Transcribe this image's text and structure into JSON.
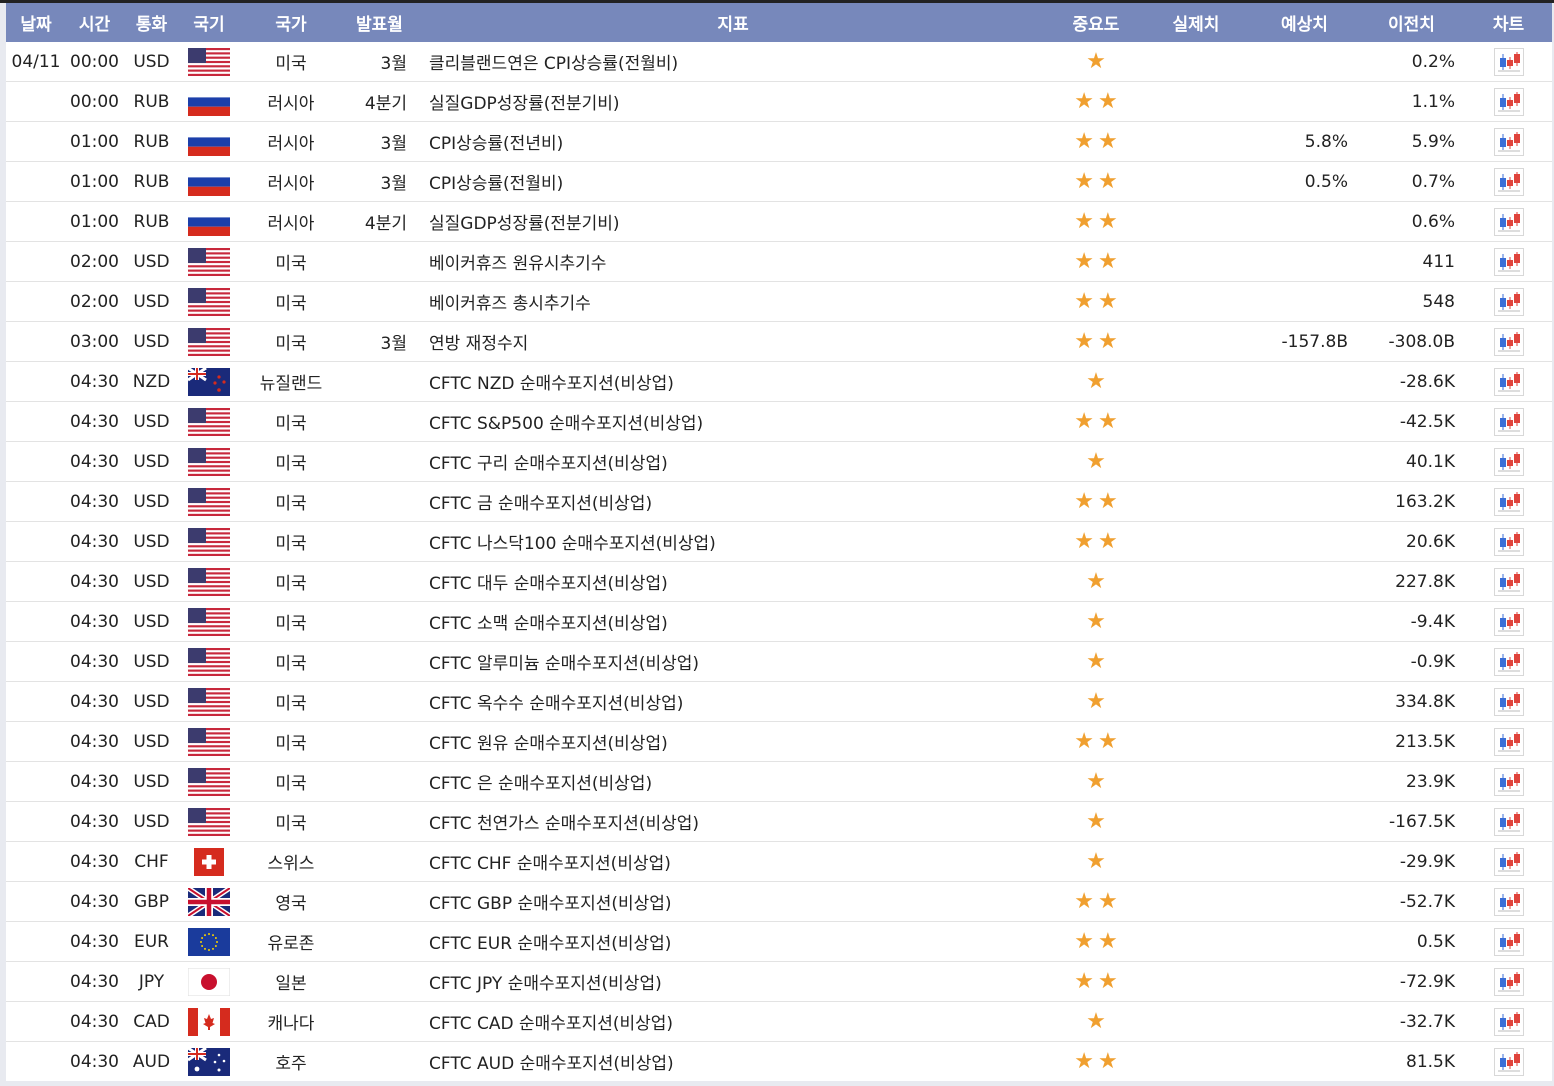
{
  "header": {
    "date": "날짜",
    "time": "시간",
    "currency": "통화",
    "flag": "국기",
    "country": "국가",
    "month": "발표월",
    "indicator": "지표",
    "importance": "중요도",
    "actual": "실제치",
    "forecast": "예상치",
    "previous": "이전치",
    "chart": "차트"
  },
  "colors": {
    "header_bg": "#7788bb",
    "star": "#f0a030",
    "chart_red": "#e0433b",
    "chart_blue": "#3b6fd8"
  },
  "rows": [
    {
      "date": "04/11",
      "time": "00:00",
      "currency": "USD",
      "flag": "us-flag",
      "country": "미국",
      "month": "3월",
      "indicator": "클리블랜드연은 CPI상승률(전월비)",
      "importance": "★",
      "actual": "",
      "forecast": "",
      "previous": "0.2%"
    },
    {
      "date": "",
      "time": "00:00",
      "currency": "RUB",
      "flag": "ru-flag",
      "country": "러시아",
      "month": "4분기",
      "indicator": "실질GDP성장률(전분기비)",
      "importance": "★★",
      "actual": "",
      "forecast": "",
      "previous": "1.1%"
    },
    {
      "date": "",
      "time": "01:00",
      "currency": "RUB",
      "flag": "ru-flag",
      "country": "러시아",
      "month": "3월",
      "indicator": "CPI상승률(전년비)",
      "importance": "★★",
      "actual": "",
      "forecast": "5.8%",
      "previous": "5.9%"
    },
    {
      "date": "",
      "time": "01:00",
      "currency": "RUB",
      "flag": "ru-flag",
      "country": "러시아",
      "month": "3월",
      "indicator": "CPI상승률(전월비)",
      "importance": "★★",
      "actual": "",
      "forecast": "0.5%",
      "previous": "0.7%"
    },
    {
      "date": "",
      "time": "01:00",
      "currency": "RUB",
      "flag": "ru-flag",
      "country": "러시아",
      "month": "4분기",
      "indicator": "실질GDP성장률(전분기비)",
      "importance": "★★",
      "actual": "",
      "forecast": "",
      "previous": "0.6%"
    },
    {
      "date": "",
      "time": "02:00",
      "currency": "USD",
      "flag": "us-flag",
      "country": "미국",
      "month": "",
      "indicator": "베이커휴즈 원유시추기수",
      "importance": "★★",
      "actual": "",
      "forecast": "",
      "previous": "411"
    },
    {
      "date": "",
      "time": "02:00",
      "currency": "USD",
      "flag": "us-flag",
      "country": "미국",
      "month": "",
      "indicator": "베이커휴즈 총시추기수",
      "importance": "★★",
      "actual": "",
      "forecast": "",
      "previous": "548"
    },
    {
      "date": "",
      "time": "03:00",
      "currency": "USD",
      "flag": "us-flag",
      "country": "미국",
      "month": "3월",
      "indicator": "연방 재정수지",
      "importance": "★★",
      "actual": "",
      "forecast": "-157.8B",
      "previous": "-308.0B"
    },
    {
      "date": "",
      "time": "04:30",
      "currency": "NZD",
      "flag": "nz-flag",
      "country": "뉴질랜드",
      "month": "",
      "indicator": "CFTC NZD 순매수포지션(비상업)",
      "importance": "★",
      "actual": "",
      "forecast": "",
      "previous": "-28.6K"
    },
    {
      "date": "",
      "time": "04:30",
      "currency": "USD",
      "flag": "us-flag",
      "country": "미국",
      "month": "",
      "indicator": "CFTC S&P500 순매수포지션(비상업)",
      "importance": "★★",
      "actual": "",
      "forecast": "",
      "previous": "-42.5K"
    },
    {
      "date": "",
      "time": "04:30",
      "currency": "USD",
      "flag": "us-flag",
      "country": "미국",
      "month": "",
      "indicator": "CFTC 구리 순매수포지션(비상업)",
      "importance": "★",
      "actual": "",
      "forecast": "",
      "previous": "40.1K"
    },
    {
      "date": "",
      "time": "04:30",
      "currency": "USD",
      "flag": "us-flag",
      "country": "미국",
      "month": "",
      "indicator": "CFTC 금 순매수포지션(비상업)",
      "importance": "★★",
      "actual": "",
      "forecast": "",
      "previous": "163.2K"
    },
    {
      "date": "",
      "time": "04:30",
      "currency": "USD",
      "flag": "us-flag",
      "country": "미국",
      "month": "",
      "indicator": "CFTC 나스닥100 순매수포지션(비상업)",
      "importance": "★★",
      "actual": "",
      "forecast": "",
      "previous": "20.6K"
    },
    {
      "date": "",
      "time": "04:30",
      "currency": "USD",
      "flag": "us-flag",
      "country": "미국",
      "month": "",
      "indicator": "CFTC 대두 순매수포지션(비상업)",
      "importance": "★",
      "actual": "",
      "forecast": "",
      "previous": "227.8K"
    },
    {
      "date": "",
      "time": "04:30",
      "currency": "USD",
      "flag": "us-flag",
      "country": "미국",
      "month": "",
      "indicator": "CFTC 소맥 순매수포지션(비상업)",
      "importance": "★",
      "actual": "",
      "forecast": "",
      "previous": "-9.4K"
    },
    {
      "date": "",
      "time": "04:30",
      "currency": "USD",
      "flag": "us-flag",
      "country": "미국",
      "month": "",
      "indicator": "CFTC 알루미늄 순매수포지션(비상업)",
      "importance": "★",
      "actual": "",
      "forecast": "",
      "previous": "-0.9K"
    },
    {
      "date": "",
      "time": "04:30",
      "currency": "USD",
      "flag": "us-flag",
      "country": "미국",
      "month": "",
      "indicator": "CFTC 옥수수 순매수포지션(비상업)",
      "importance": "★",
      "actual": "",
      "forecast": "",
      "previous": "334.8K"
    },
    {
      "date": "",
      "time": "04:30",
      "currency": "USD",
      "flag": "us-flag",
      "country": "미국",
      "month": "",
      "indicator": "CFTC 원유 순매수포지션(비상업)",
      "importance": "★★",
      "actual": "",
      "forecast": "",
      "previous": "213.5K"
    },
    {
      "date": "",
      "time": "04:30",
      "currency": "USD",
      "flag": "us-flag",
      "country": "미국",
      "month": "",
      "indicator": "CFTC 은 순매수포지션(비상업)",
      "importance": "★",
      "actual": "",
      "forecast": "",
      "previous": "23.9K"
    },
    {
      "date": "",
      "time": "04:30",
      "currency": "USD",
      "flag": "us-flag",
      "country": "미국",
      "month": "",
      "indicator": "CFTC 천연가스 순매수포지션(비상업)",
      "importance": "★",
      "actual": "",
      "forecast": "",
      "previous": "-167.5K"
    },
    {
      "date": "",
      "time": "04:30",
      "currency": "CHF",
      "flag": "ch-flag",
      "country": "스위스",
      "month": "",
      "indicator": "CFTC CHF 순매수포지션(비상업)",
      "importance": "★",
      "actual": "",
      "forecast": "",
      "previous": "-29.9K"
    },
    {
      "date": "",
      "time": "04:30",
      "currency": "GBP",
      "flag": "gb-flag",
      "country": "영국",
      "month": "",
      "indicator": "CFTC GBP 순매수포지션(비상업)",
      "importance": "★★",
      "actual": "",
      "forecast": "",
      "previous": "-52.7K"
    },
    {
      "date": "",
      "time": "04:30",
      "currency": "EUR",
      "flag": "eu-flag",
      "country": "유로존",
      "month": "",
      "indicator": "CFTC EUR 순매수포지션(비상업)",
      "importance": "★★",
      "actual": "",
      "forecast": "",
      "previous": "0.5K"
    },
    {
      "date": "",
      "time": "04:30",
      "currency": "JPY",
      "flag": "jp-flag",
      "country": "일본",
      "month": "",
      "indicator": "CFTC JPY 순매수포지션(비상업)",
      "importance": "★★",
      "actual": "",
      "forecast": "",
      "previous": "-72.9K"
    },
    {
      "date": "",
      "time": "04:30",
      "currency": "CAD",
      "flag": "ca-flag",
      "country": "캐나다",
      "month": "",
      "indicator": "CFTC CAD 순매수포지션(비상업)",
      "importance": "★",
      "actual": "",
      "forecast": "",
      "previous": "-32.7K"
    },
    {
      "date": "",
      "time": "04:30",
      "currency": "AUD",
      "flag": "au-flag",
      "country": "호주",
      "month": "",
      "indicator": "CFTC AUD 순매수포지션(비상업)",
      "importance": "★★",
      "actual": "",
      "forecast": "",
      "previous": "81.5K"
    }
  ]
}
